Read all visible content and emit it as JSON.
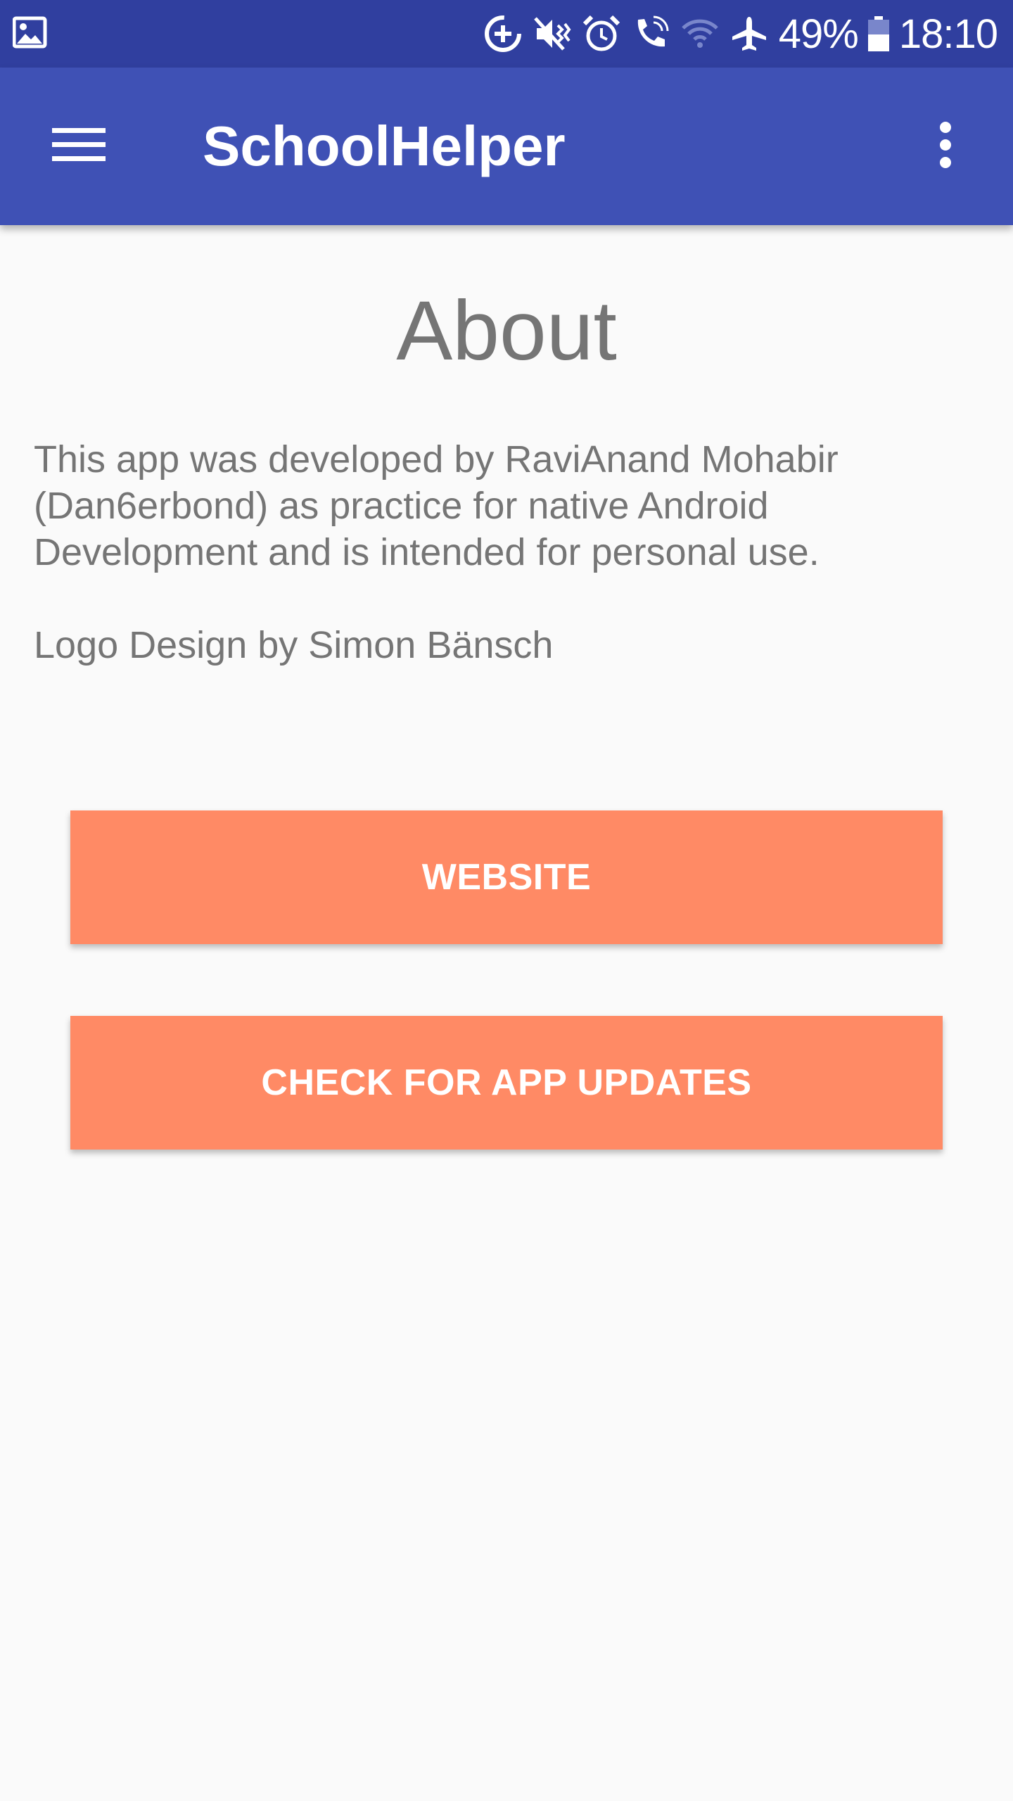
{
  "status_bar": {
    "battery_percent": "49%",
    "time": "18:10",
    "icons": [
      "image-notification-icon",
      "data-saver-icon",
      "mute-vibrate-icon",
      "alarm-icon",
      "wifi-calling-icon",
      "wifi-icon",
      "airplane-mode-icon",
      "battery-icon"
    ]
  },
  "app_bar": {
    "title": "SchoolHelper",
    "menu_icon": "hamburger-menu-icon",
    "overflow_icon": "more-vert-icon"
  },
  "about": {
    "heading": "About",
    "description": "This app was developed by RaviAnand Mohabir (Dan6erbond) as practice for native Android Development and is intended for personal use.",
    "logo_credit": "Logo Design by Simon Bänsch"
  },
  "buttons": {
    "website": "WEBSITE",
    "check_updates": "CHECK FOR APP UPDATES"
  },
  "colors": {
    "status_bar": "#303f9f",
    "app_bar": "#3f51b5",
    "button": "#ff8a65",
    "text": "#757575",
    "background": "#fafafa"
  }
}
